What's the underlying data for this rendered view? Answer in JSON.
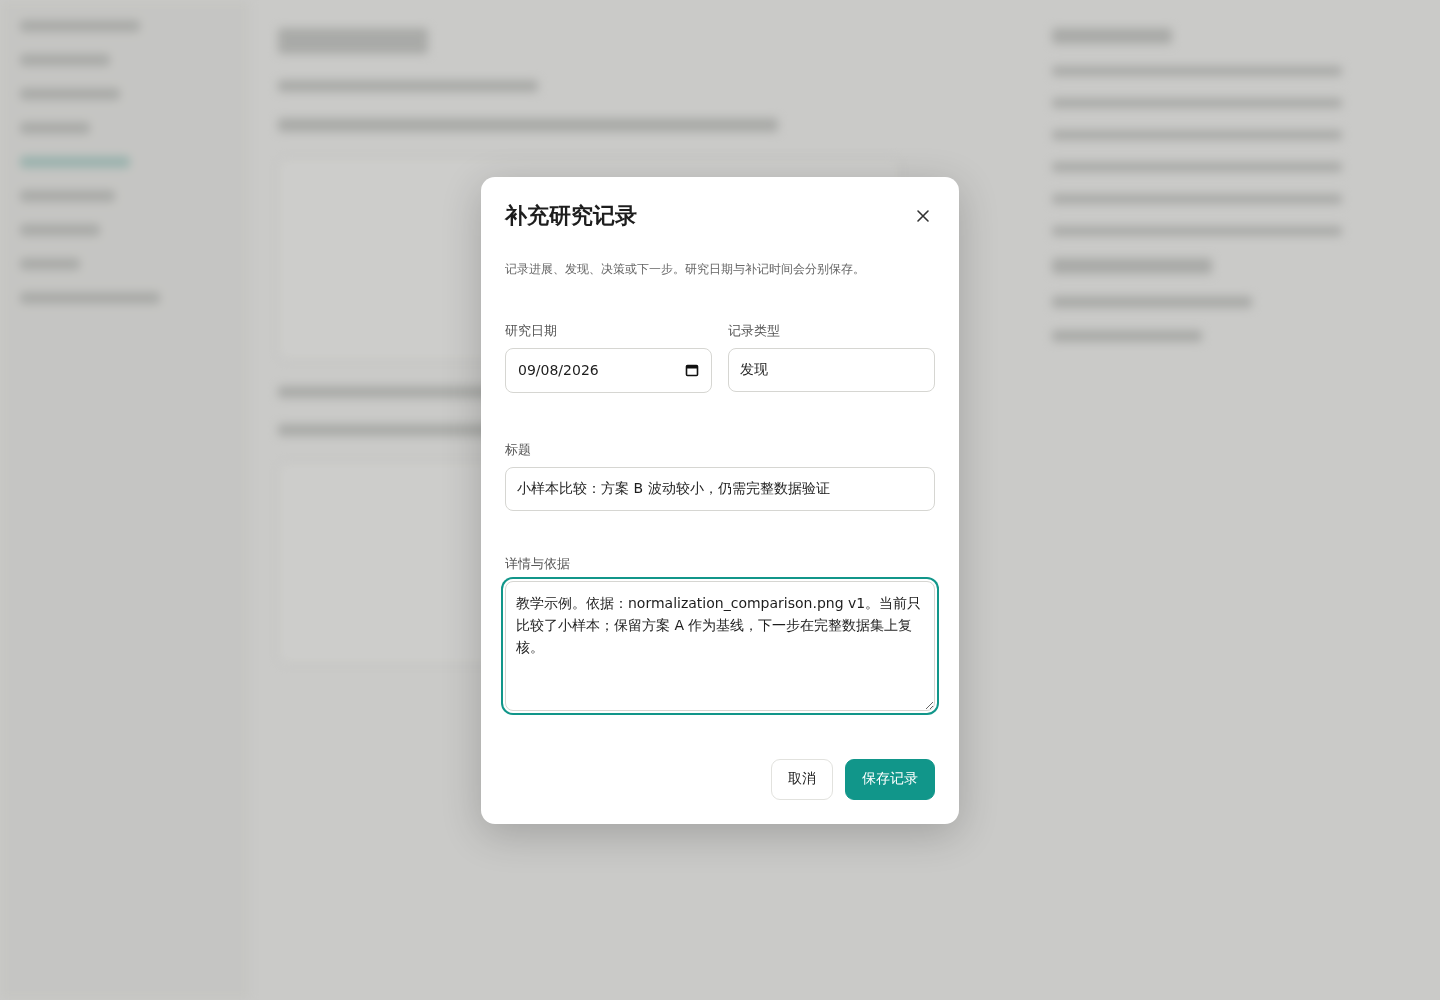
{
  "dialog": {
    "title": "补充研究记录",
    "description": "记录进展、发现、决策或下一步。研究日期与补记时间会分别保存。",
    "fields": [
      {
        "kind": "date",
        "label": "研究日期",
        "value": "09/08/2026",
        "focused": false
      },
      {
        "kind": "text",
        "label": "记录类型",
        "value": "发现",
        "focused": false
      },
      {
        "kind": "text",
        "label": "标题",
        "value": "小样本比较：方案 B 波动较小，仍需完整数据验证",
        "focused": false
      },
      {
        "kind": "textarea",
        "label": "详情与依据",
        "value": "教学示例。依据：normalization_comparison.png v1。当前只比较了小样本；保留方案 A 作为基线，下一步在完整数据集上复核。",
        "focused": true
      }
    ],
    "buttons": [
      {
        "kind": "secondary",
        "label": "取消"
      },
      {
        "kind": "primary",
        "label": "保存记录"
      }
    ]
  }
}
